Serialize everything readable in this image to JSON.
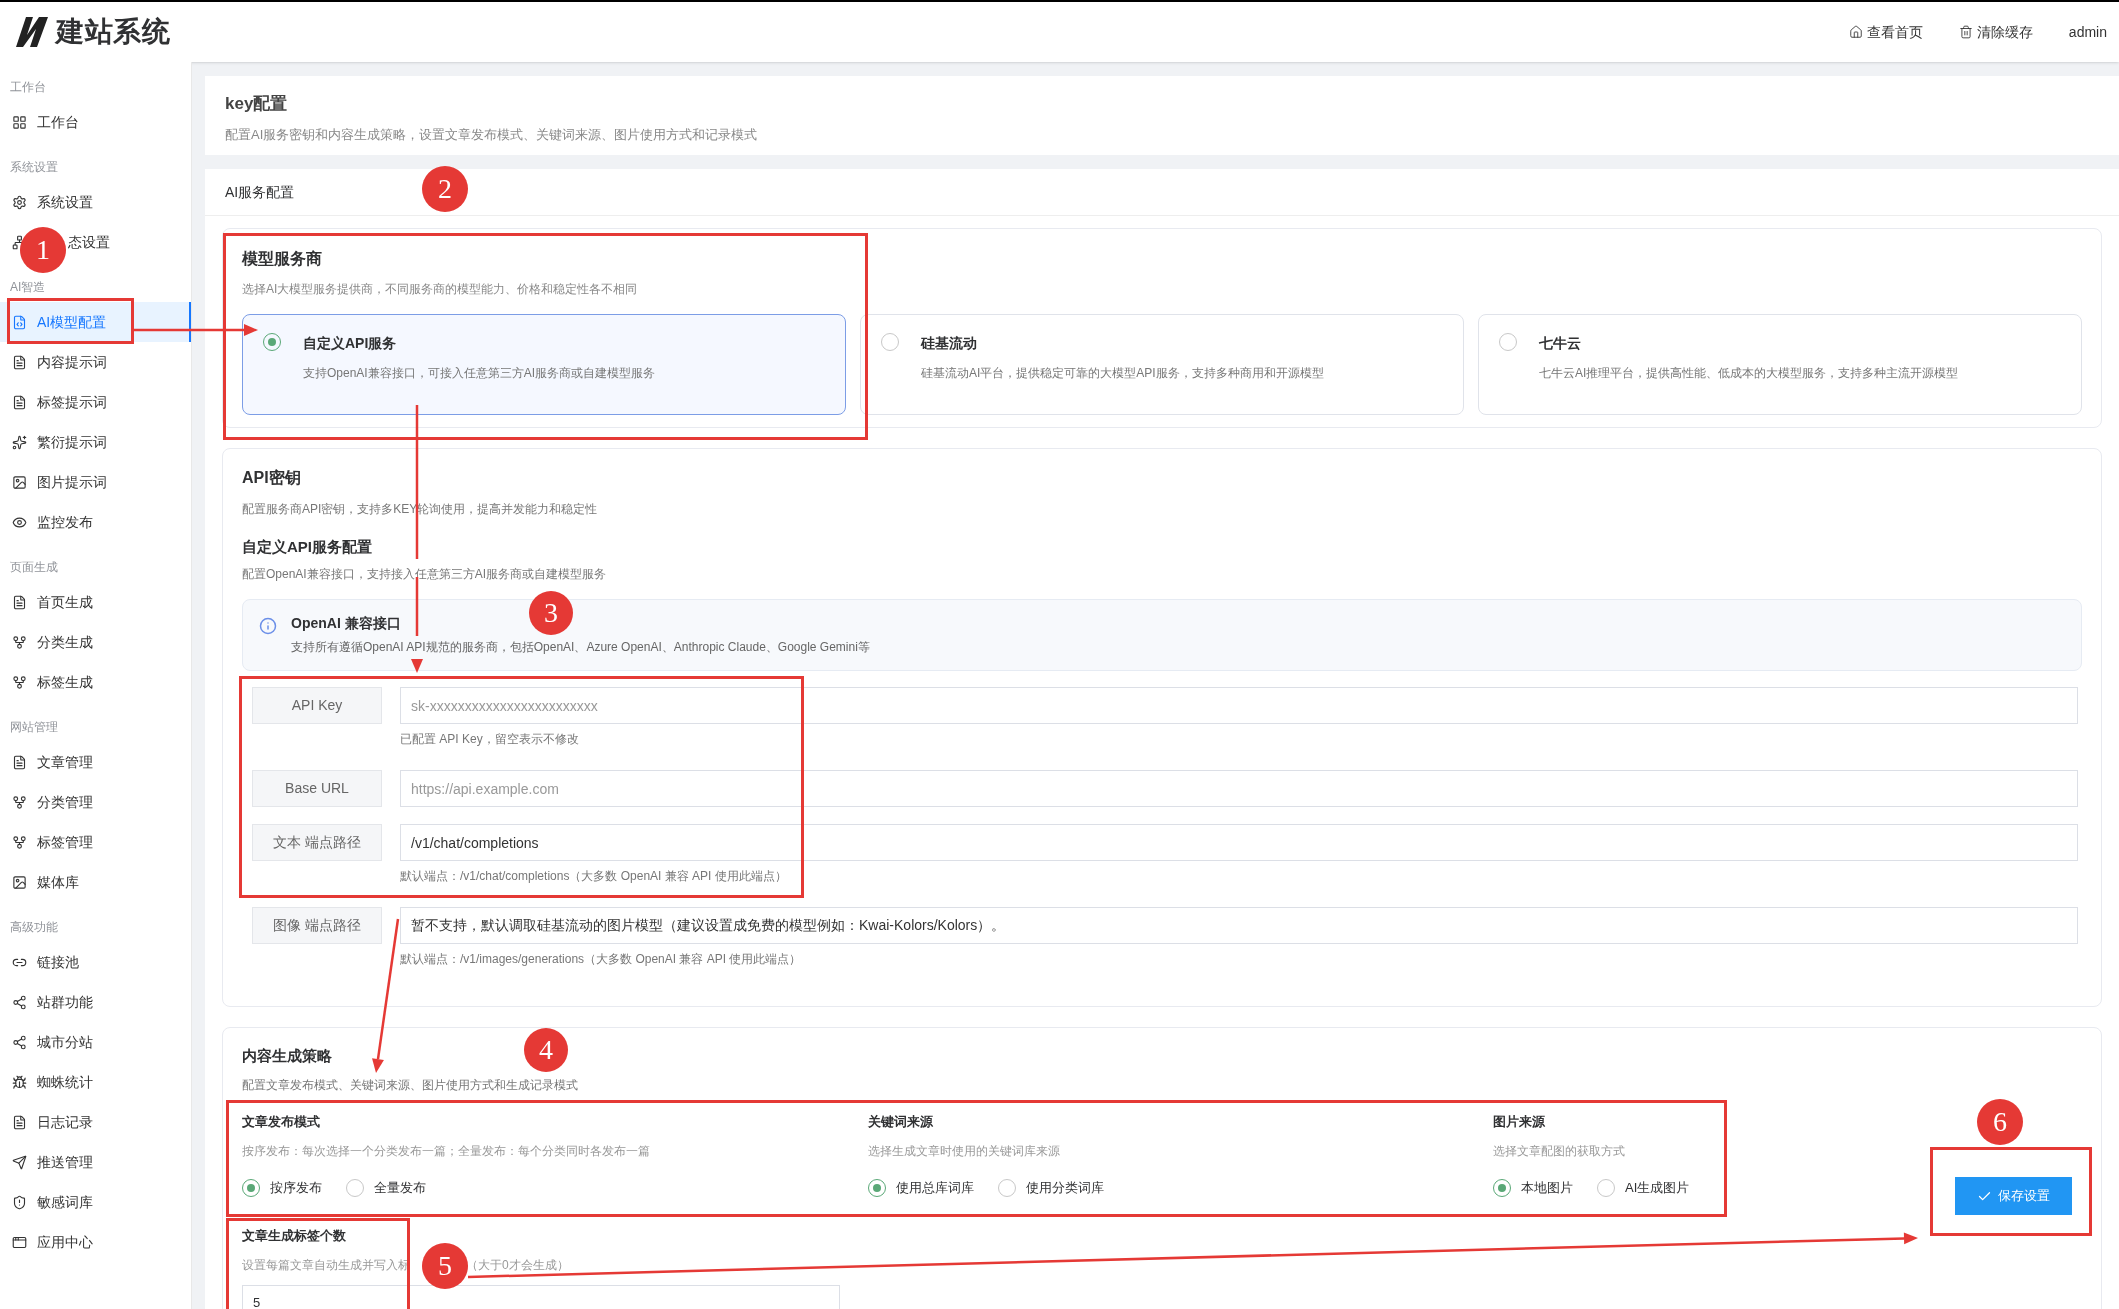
{
  "header": {
    "logo_text": "建站系统",
    "actions": [
      {
        "label": "查看首页"
      },
      {
        "label": "清除缓存"
      }
    ],
    "user": "admin"
  },
  "sidebar": {
    "groups": [
      {
        "title": "工作台",
        "items": [
          {
            "label": "工作台",
            "selected": false
          }
        ]
      },
      {
        "title": "系统设置",
        "items": [
          {
            "label": "系统设置",
            "selected": false
          },
          {
            "label": "态设置",
            "selected": false
          }
        ]
      },
      {
        "title": "AI智造",
        "items": [
          {
            "label": "AI模型配置",
            "selected": true
          },
          {
            "label": "内容提示词",
            "selected": false
          },
          {
            "label": "标签提示词",
            "selected": false
          },
          {
            "label": "繁衍提示词",
            "selected": false
          },
          {
            "label": "图片提示词",
            "selected": false
          },
          {
            "label": "监控发布",
            "selected": false
          }
        ]
      },
      {
        "title": "页面生成",
        "items": [
          {
            "label": "首页生成",
            "selected": false
          },
          {
            "label": "分类生成",
            "selected": false
          },
          {
            "label": "标签生成",
            "selected": false
          }
        ]
      },
      {
        "title": "网站管理",
        "items": [
          {
            "label": "文章管理",
            "selected": false
          },
          {
            "label": "分类管理",
            "selected": false
          },
          {
            "label": "标签管理",
            "selected": false
          },
          {
            "label": "媒体库",
            "selected": false
          }
        ]
      },
      {
        "title": "高级功能",
        "items": [
          {
            "label": "链接池",
            "selected": false
          },
          {
            "label": "站群功能",
            "selected": false
          },
          {
            "label": "城市分站",
            "selected": false
          },
          {
            "label": "蜘蛛统计",
            "selected": false
          },
          {
            "label": "日志记录",
            "selected": false
          },
          {
            "label": "推送管理",
            "selected": false
          },
          {
            "label": "敏感词库",
            "selected": false
          },
          {
            "label": "应用中心",
            "selected": false
          }
        ]
      }
    ]
  },
  "page": {
    "title": "key配置",
    "description": "配置AI服务密钥和内容生成策略，设置文章发布模式、关键词来源、图片使用方式和记录模式"
  },
  "ai_service": {
    "title": "AI服务配置",
    "provider": {
      "title": "模型服务商",
      "description": "选择AI大模型服务提供商，不同服务商的模型能力、价格和稳定性各不相同",
      "options": [
        {
          "name": "自定义API服务",
          "description": "支持OpenAI兼容接口，可接入任意第三方AI服务商或自建模型服务",
          "selected": true
        },
        {
          "name": "硅基流动",
          "description": "硅基流动AI平台，提供稳定可靠的大模型API服务，支持多种商用和开源模型",
          "selected": false
        },
        {
          "name": "七牛云",
          "description": "七牛云AI推理平台，提供高性能、低成本的大模型服务，支持多种主流开源模型",
          "selected": false
        }
      ]
    },
    "api_key": {
      "title": "API密钥",
      "description": "配置服务商API密钥，支持多KEY轮询使用，提高并发能力和稳定性",
      "subtitle": "自定义API服务配置",
      "subdescription": "配置OpenAI兼容接口，支持接入任意第三方AI服务商或自建模型服务",
      "notice": {
        "title": "OpenAI 兼容接口",
        "text": "支持所有遵循OpenAI API规范的服务商，包括OpenAI、Azure OpenAI、Anthropic Claude、Google Gemini等"
      },
      "fields": [
        {
          "label": "API Key",
          "placeholder": "sk-xxxxxxxxxxxxxxxxxxxxxxxx",
          "hint": "已配置 API Key，留空表示不修改"
        },
        {
          "label": "Base URL",
          "placeholder": "https://api.example.com"
        },
        {
          "label": "文本 端点路径",
          "value": "/v1/chat/completions",
          "hint": "默认端点：/v1/chat/completions（大多数 OpenAI 兼容 API 使用此端点）"
        },
        {
          "label": "图像 端点路径",
          "value": "暂不支持，默认调取硅基流动的图片模型（建议设置成免费的模型例如：Kwai-Kolors/Kolors）。",
          "hint": "默认端点：/v1/images/generations（大多数 OpenAI 兼容 API 使用此端点）"
        }
      ]
    }
  },
  "content_strategy": {
    "title": "内容生成策略",
    "description": "配置文章发布模式、关键词来源、图片使用方式和生成记录模式",
    "groups": [
      {
        "title": "文章发布模式",
        "description": "按序发布：每次选择一个分类发布一篇；全量发布：每个分类同时各发布一篇",
        "options": [
          {
            "label": "按序发布",
            "selected": true
          },
          {
            "label": "全量发布",
            "selected": false
          }
        ]
      },
      {
        "title": "关键词来源",
        "description": "选择生成文章时使用的关键词库来源",
        "options": [
          {
            "label": "使用总库词库",
            "selected": true
          },
          {
            "label": "使用分类词库",
            "selected": false
          }
        ]
      },
      {
        "title": "图片来源",
        "description": "选择文章配图的获取方式",
        "options": [
          {
            "label": "本地图片",
            "selected": true
          },
          {
            "label": "AI生成图片",
            "selected": false
          }
        ]
      }
    ],
    "tag_count": {
      "title": "文章生成标签个数",
      "description_parts": [
        "设置每篇文章自动生成并写入标",
        "（大于0才会生成）"
      ],
      "value": "5"
    },
    "save_button": "保存设置"
  },
  "annotations": [
    "1",
    "2",
    "3",
    "4",
    "5",
    "6"
  ]
}
